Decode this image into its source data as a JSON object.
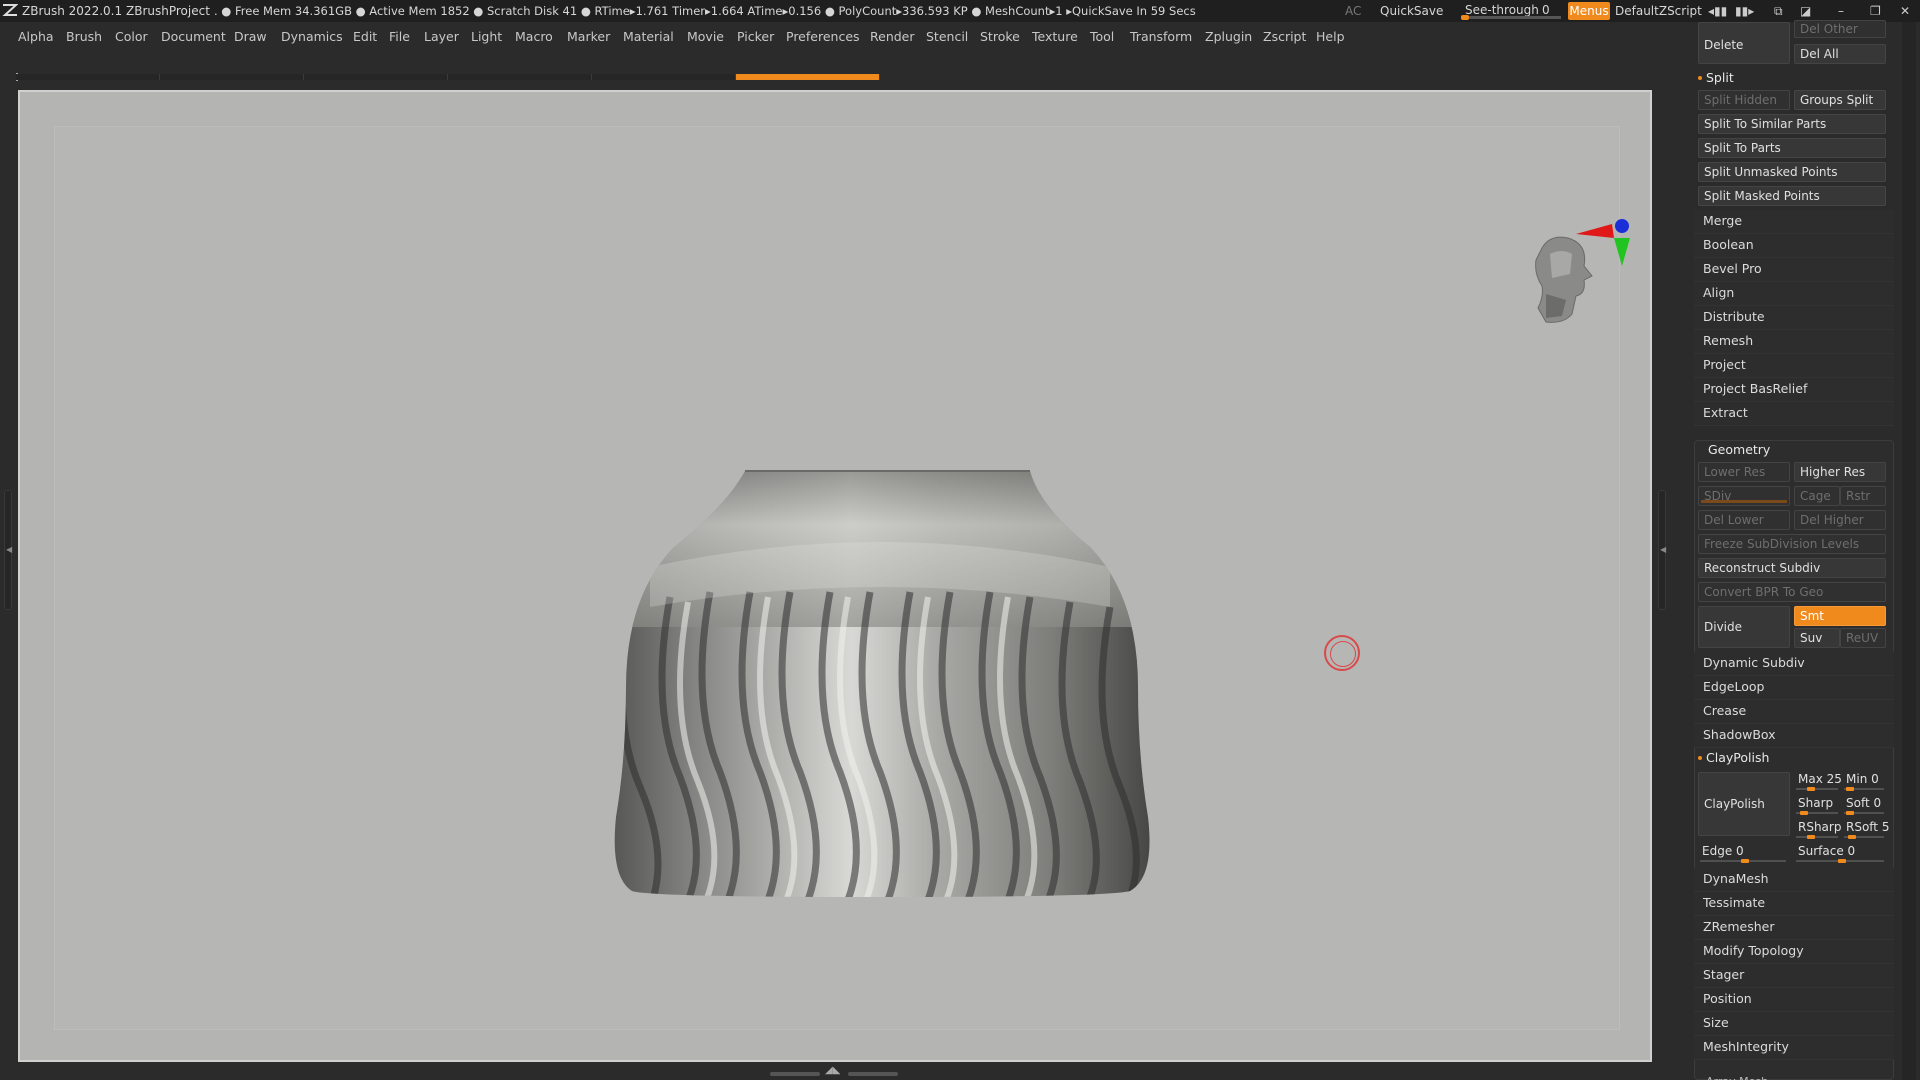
{
  "titlebar": {
    "app": "ZBrush 2022.0.1",
    "project": "ZBrushProject",
    "stats": ". ● Free Mem 34.361GB ● Active Mem 1852 ● Scratch Disk 41 ●  RTime▸1.761 Timer▸1.664 ATime▸0.156 ● PolyCount▸336.593 KP  ● MeshCount▸1   ▸QuickSave In 59 Secs",
    "ac": "AC",
    "quicksave": "QuickSave",
    "see_through_label": "See-through",
    "see_through_value": "0",
    "see_through_level": 0,
    "menus": "Menus",
    "script": "DefaultZScript"
  },
  "menubar": [
    "Alpha",
    "Brush",
    "Color",
    "Document",
    "Draw",
    "Dynamics",
    "Edit",
    "File",
    "Layer",
    "Light",
    "Macro",
    "Marker",
    "Material",
    "Movie",
    "Picker",
    "Preferences",
    "Render",
    "Stencil",
    "Stroke",
    "Texture",
    "Tool",
    "Transform",
    "Zplugin",
    "Zscript",
    "Help"
  ],
  "docstrip": {
    "segments": 6,
    "active_index": 5
  },
  "panel": {
    "del_other": "Del Other",
    "delete": "Delete",
    "del_all": "Del All",
    "split_header": "Split",
    "split_hidden": "Split Hidden",
    "groups_split": "Groups Split",
    "split_similar": "Split To Similar Parts",
    "split_parts": "Split To Parts",
    "split_unmasked": "Split Unmasked Points",
    "split_masked": "Split Masked Points",
    "merge": "Merge",
    "boolean": "Boolean",
    "bevel_pro": "Bevel Pro",
    "align": "Align",
    "distribute": "Distribute",
    "remesh": "Remesh",
    "project": "Project",
    "project_basrelief": "Project BasRelief",
    "extract": "Extract",
    "geometry_header": "Geometry",
    "lower_res": "Lower Res",
    "higher_res": "Higher Res",
    "sdiv": "SDiv",
    "cage": "Cage",
    "rstr": "Rstr",
    "del_lower": "Del Lower",
    "del_higher": "Del Higher",
    "freeze_subdiv": "Freeze SubDivision Levels",
    "reconstruct_subdiv": "Reconstruct Subdiv",
    "convert_bpr": "Convert BPR To Geo",
    "divide": "Divide",
    "smt": "Smt",
    "suv": "Suv",
    "reuv": "ReUV",
    "dynamic_subdiv": "Dynamic Subdiv",
    "edgeloop": "EdgeLoop",
    "crease": "Crease",
    "shadowbox": "ShadowBox",
    "claypolish_header": "ClayPolish",
    "claypolish_btn": "ClayPolish",
    "max": {
      "label": "Max",
      "value": 25,
      "level": 0.25
    },
    "min": {
      "label": "Min",
      "value": 0,
      "level": 0
    },
    "sharp": {
      "label": "Sharp",
      "value": "",
      "level": 0.05
    },
    "soft": {
      "label": "Soft",
      "value": 0,
      "level": 0
    },
    "rsharp": {
      "label": "RSharp",
      "value": "",
      "level": 0.25
    },
    "rsoft": {
      "label": "RSoft",
      "value": 5,
      "level": 0.05
    },
    "edge": {
      "label": "Edge",
      "value": 0,
      "level": 0.5
    },
    "surface": {
      "label": "Surface",
      "value": 0,
      "level": 0.5
    },
    "dynamesh": "DynaMesh",
    "tessimate": "Tessimate",
    "zremesher": "ZRemesher",
    "modify_topology": "Modify Topology",
    "stager": "Stager",
    "position": "Position",
    "size": "Size",
    "meshintegrity": "MeshIntegrity",
    "array_mesh": "Array Mesh"
  },
  "colors": {
    "accent": "#f08a1c",
    "canvas": "#b6b6b4",
    "panel": "#2b2b2b"
  }
}
